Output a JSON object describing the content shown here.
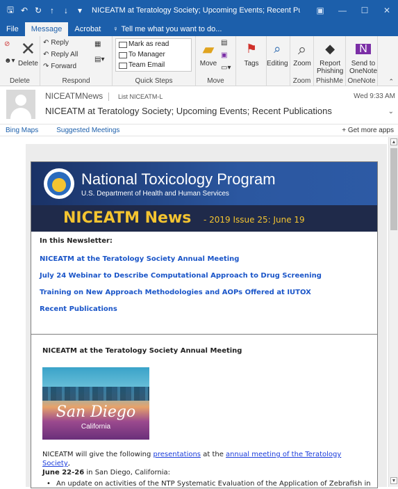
{
  "window": {
    "title": "NICEATM at Teratology Society; Upcoming Events; Recent Publi..."
  },
  "tabs": [
    "File",
    "Message",
    "Acrobat"
  ],
  "tell_me": "Tell me what you want to do...",
  "ribbon": {
    "delete_group": {
      "delete": "Delete",
      "label": "Delete"
    },
    "respond_group": {
      "reply": "Reply",
      "reply_all": "Reply All",
      "forward": "Forward",
      "label": "Respond"
    },
    "quick_steps": {
      "items": [
        "Mark as read",
        "To Manager",
        "Team Email"
      ],
      "label": "Quick Steps"
    },
    "move_group": {
      "move": "Move",
      "label": "Move"
    },
    "tags": "Tags",
    "editing": "Editing",
    "zoom": {
      "zoom": "Zoom",
      "label": "Zoom"
    },
    "phishme": {
      "report1": "Report",
      "report2": "Phishing",
      "label": "PhishMe"
    },
    "onenote": {
      "send1": "Send to",
      "send2": "OneNote",
      "label": "OneNote"
    }
  },
  "header": {
    "sender": "NICEATMNews",
    "to": "List NICEATM-L",
    "time": "Wed 9:33 AM",
    "subject": "NICEATM at Teratology Society; Upcoming Events; Recent Publications"
  },
  "addins": {
    "bing": "Bing Maps",
    "suggested": "Suggested Meetings",
    "more": "Get more apps"
  },
  "newsletter": {
    "ntp": "National Toxicology Program",
    "hhs": "U.S. Department of Health and Human Services",
    "title": "NICEATM News",
    "issue": "- 2019 Issue 25: June 19",
    "toc_heading": "In this Newsletter:",
    "toc": [
      "NICEATM at the Teratology Society Annual Meeting",
      "July 24 Webinar to Describe Computational Approach to Drug Screening",
      "Training on New Approach Methodologies and AOPs Offered at IUTOX",
      "Recent Publications"
    ],
    "section_heading": "NICEATM at the Teratology Society Annual Meeting",
    "image_text1": "San Diego",
    "image_text2": "California",
    "para_pre": "NICEATM will give the following ",
    "para_link1": "presentations",
    "para_mid": " at the ",
    "para_link2": "annual meeting of the Teratology Society",
    "para_post1": ",",
    "para_bold": "June 22-26",
    "para_post2": " in San Diego, California:",
    "bullet1": "An update on activities of the NTP Systematic Evaluation of the Application of Zebrafish in"
  }
}
